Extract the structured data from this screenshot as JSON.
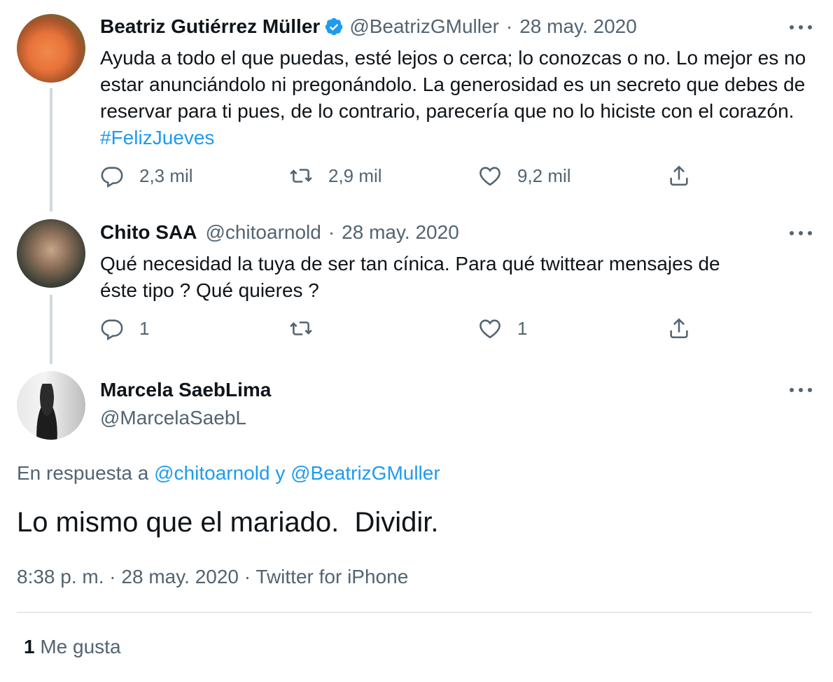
{
  "tweets": [
    {
      "name": "Beatriz Gutiérrez Müller",
      "verified": true,
      "handle": "@BeatrizGMuller",
      "date": "28 may. 2020",
      "text": "Ayuda a todo el que puedas, esté lejos o cerca; lo conozcas o no. Lo mejor es no estar anunciándolo ni pregonándolo. La generosidad es un secreto que debes de reservar para ti pues, de lo contrario, parecería que no lo hiciste con el corazón.",
      "hashtag": "#FelizJueves",
      "replies": "2,3 mil",
      "retweets": "2,9 mil",
      "likes": "9,2 mil"
    },
    {
      "name": "Chito SAA",
      "handle": "@chitoarnold",
      "date": "28 may. 2020",
      "text_line1": "Qué necesidad la tuya de ser tan cínica. Para qué twittear mensajes de",
      "text_line2": "éste tipo ? Qué quieres ?",
      "replies": "1",
      "retweets": "",
      "likes": "1"
    }
  ],
  "focus": {
    "name": "Marcela SaebLima",
    "handle": "@MarcelaSaebL",
    "reply_prefix": "En respuesta a",
    "reply_user1": "@chitoarnold",
    "reply_conj": "y",
    "reply_user2": "@BeatrizGMuller",
    "text": "Lo mismo que el mariado.  Dividir.",
    "time": "8:38 p. m.",
    "date": "28 may. 2020",
    "source": "Twitter for iPhone",
    "like_count": "1",
    "like_label": "Me gusta"
  },
  "colors": {
    "accent": "#1d9bf0",
    "muted": "#536471",
    "text": "#0f1419"
  },
  "icons": [
    "verified-icon",
    "more-icon",
    "reply-icon",
    "retweet-icon",
    "like-icon",
    "share-icon"
  ]
}
